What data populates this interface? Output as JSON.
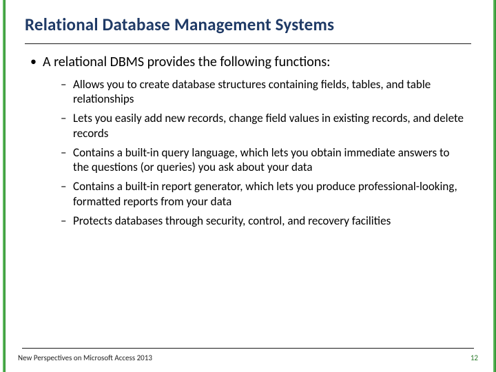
{
  "title": "Relational Database Management Systems",
  "intro": "A relational DBMS provides the following functions:",
  "points": [
    "Allows you to create database structures containing fields, tables, and table relationships",
    "Lets you easily add new records, change field values in existing records, and delete records",
    "Contains a built-in query language, which lets you obtain immediate answers to the questions (or queries) you ask about your data",
    "Contains a built-in report generator, which lets you produce professional-looking, formatted reports from your data",
    "Protects databases through security, control, and recovery facilities"
  ],
  "footer": {
    "left": "New Perspectives on Microsoft Access 2013",
    "page": "12"
  }
}
